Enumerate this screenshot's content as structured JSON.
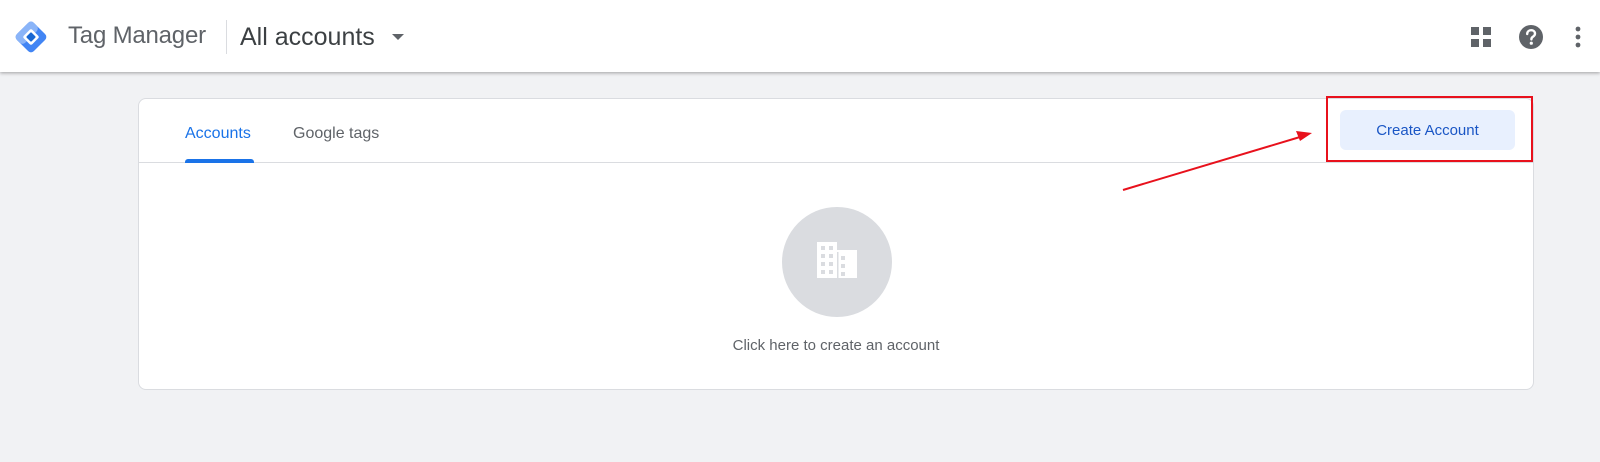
{
  "header": {
    "app_title": "Tag Manager",
    "account_selector": "All accounts"
  },
  "icons": {
    "logo": "tag-manager-logo-icon",
    "caret": "caret-down-icon",
    "apps": "apps-grid-icon",
    "help": "help-icon",
    "more": "more-vert-icon",
    "building": "building-icon"
  },
  "tabs": [
    {
      "label": "Accounts",
      "active": true
    },
    {
      "label": "Google tags",
      "active": false
    }
  ],
  "actions": {
    "create_account": "Create Account"
  },
  "empty_state": {
    "text": "Click here to create an account"
  },
  "colors": {
    "accent": "#1a73e8",
    "button_bg": "#e8f0fe",
    "annotation": "#e8111c",
    "page_bg": "#f1f2f4"
  }
}
